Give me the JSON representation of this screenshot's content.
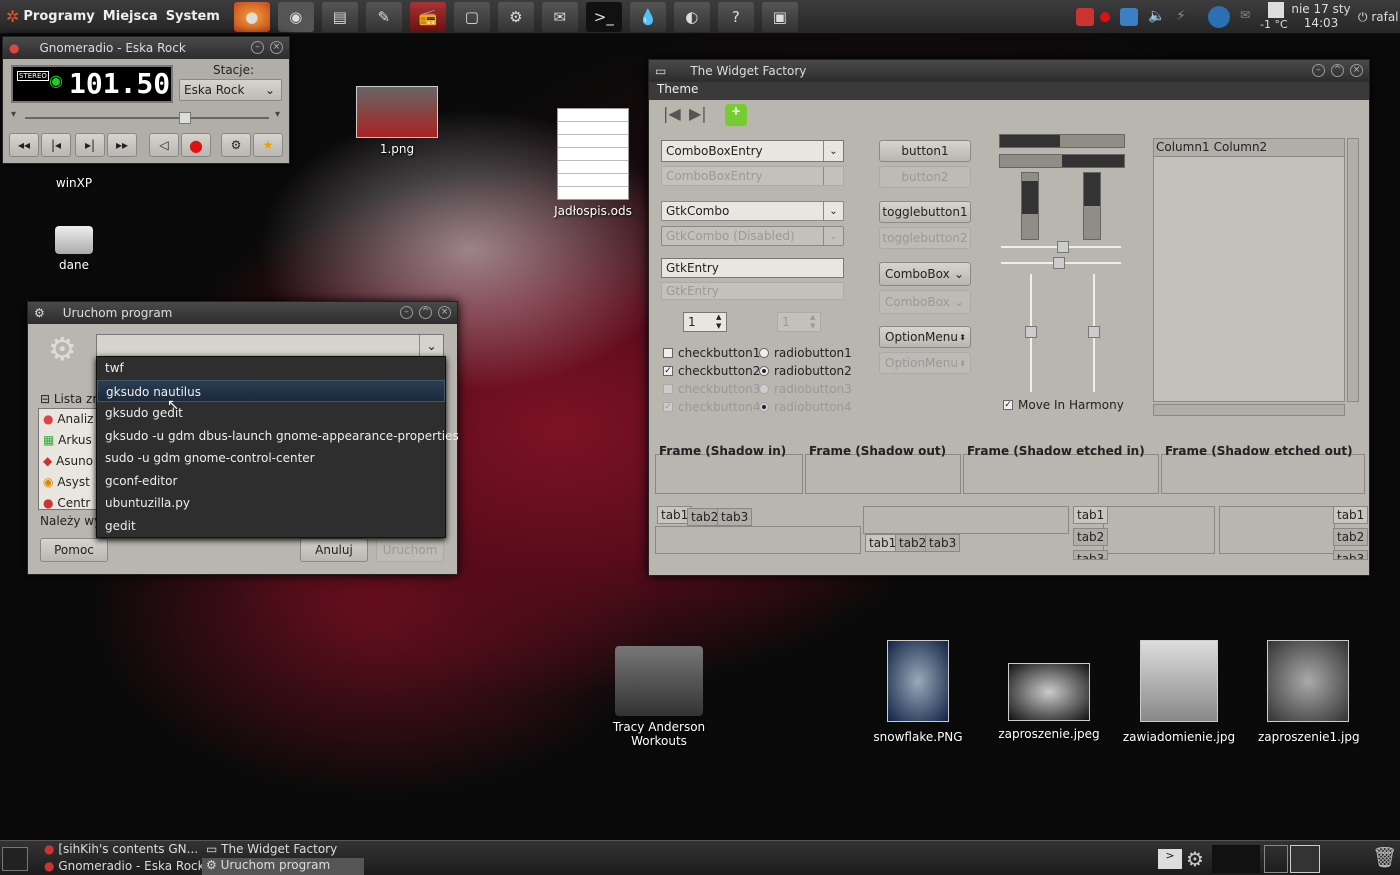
{
  "top_panel": {
    "menus": [
      "Programy",
      "Miejsca",
      "System"
    ],
    "clock_date": "nie 17 sty",
    "clock_time": "14:03",
    "temperature": "-1 °C",
    "user": "rafal"
  },
  "launchers": [
    "firefox-icon",
    "avatar-icon",
    "notes-icon",
    "gimp-icon",
    "radio-icon",
    "window-icon",
    "settings-icon",
    "package-icon",
    "terminal-icon",
    "drop-icon",
    "disk-icon",
    "help-icon",
    "screenshot-icon"
  ],
  "desktop_icons": {
    "winxp": "winXP",
    "dane": "dane",
    "png1": "1.png",
    "ods": "Jadłospis.ods",
    "folder": "Tracy Anderson Workouts",
    "snowflake": "snowflake.PNG",
    "zaproszenie": "zaproszenie.jpeg",
    "zawiadomienie": "zawiadomienie.jpg",
    "zaproszenie1": "zaproszenie1.jpg"
  },
  "radio": {
    "title": "Gnomeradio - Eska Rock",
    "stereo": "STEREO",
    "frequency": "101.50",
    "stations_label": "Stacje:",
    "station": "Eska Rock"
  },
  "run": {
    "title": "Uruchom program",
    "list_label": "Lista zn",
    "apps": [
      "Analiz",
      "Arkus",
      "Asuno",
      "Asyst",
      "Centr"
    ],
    "belongs": "Należy wy",
    "help": "Pomoc",
    "cancel": "Anuluj",
    "run": "Uruchom",
    "history": [
      "twf",
      "gksudo nautilus",
      "gksudo gedit",
      "gksudo -u gdm dbus-launch gnome-appearance-properties",
      "sudo -u gdm gnome-control-center",
      "gconf-editor",
      "ubuntuzilla.py",
      "gedit"
    ]
  },
  "wf": {
    "title": "The Widget Factory",
    "menu": "Theme",
    "comboboxentry": "ComboBoxEntry",
    "comboboxentry_dis": "ComboBoxEntry",
    "gtkcombo": "GtkCombo",
    "gtkcombo_dis": "GtkCombo (Disabled)",
    "gtkentry": "GtkEntry",
    "gtkentry_dis": "GtkEntry",
    "spin1": "1",
    "spin2": "1",
    "button1": "button1",
    "button2": "button2",
    "toggle1": "togglebutton1",
    "toggle2": "togglebutton2",
    "combobox": "ComboBox",
    "combobox_dis": "ComboBox",
    "optionmenu": "OptionMenu",
    "optionmenu_dis": "OptionMenu",
    "check1": "checkbutton1",
    "check2": "checkbutton2",
    "check3": "checkbutton3",
    "check4": "checkbutton4",
    "radio1": "radiobutton1",
    "radio2": "radiobutton2",
    "radio3": "radiobutton3",
    "radio4": "radiobutton4",
    "move_harmony": "Move In Harmony",
    "col1": "Column1",
    "col2": "Column2",
    "frames": [
      "Frame (Shadow in)",
      "Frame (Shadow out)",
      "Frame (Shadow etched in)",
      "Frame (Shadow etched out)"
    ],
    "tabs": [
      "tab1",
      "tab2",
      "tab3"
    ]
  },
  "taskbar": {
    "items": [
      "[sihKih's contents GN...",
      "The Widget Factory",
      "Gnomeradio - Eska Rock",
      "Uruchom program"
    ]
  }
}
